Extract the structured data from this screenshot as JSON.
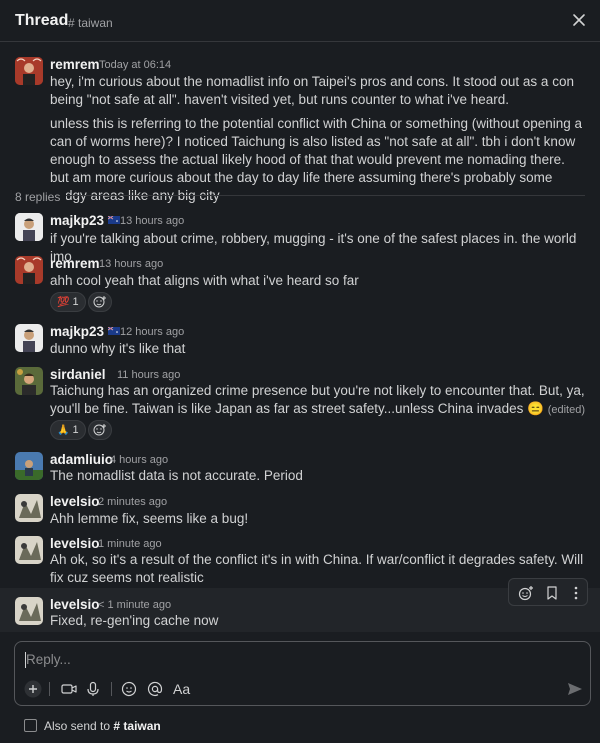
{
  "header": {
    "title": "Thread",
    "channel": "# taiwan"
  },
  "parent": {
    "user": "remrem",
    "time": "Today at 06:14",
    "para1": "hey, i'm curious about the nomadlist info on Taipei's pros and cons. It stood out as a con being \"not safe at all\". haven't visited yet, but runs counter to what i've heard.",
    "para2": "unless this is referring to the potential conflict with China or something (without opening a can of worms here)? I noticed Taichung is also listed as \"not safe at all\".  tbh i don't know enough to assess the actual likely hood of that that would prevent me nomading there. but am more curious about the day to day life there assuming there's probably some dodgy areas like any big city"
  },
  "replies_count": "8 replies",
  "replies": [
    {
      "user": "majkp23",
      "time": "13 hours ago",
      "text": "if you're talking about crime, robbery, mugging - it's one of the safest places in. the world imo"
    },
    {
      "user": "remrem",
      "time": "13 hours ago",
      "text": "ahh cool yeah that aligns with what i've heard so far",
      "reaction": {
        "emoji": "💯",
        "count": "1"
      }
    },
    {
      "user": "majkp23",
      "time": "12 hours ago",
      "text": "dunno why it's like that"
    },
    {
      "user": "sirdaniel",
      "time": "11 hours ago",
      "text": "Taichung has an organized crime presence but you're not likely to encounter that. But, ya, you'll be fine. Taiwan is like Japan as far as street safety...unless China invades",
      "emoji_inline": "😑",
      "edited": "(edited)",
      "reaction": {
        "emoji": "🙏",
        "count": "1"
      }
    },
    {
      "user": "adamliuio",
      "time": "4 hours ago",
      "text": "The nomadlist data is not accurate. Period"
    },
    {
      "user": "levelsio",
      "time": "2 minutes ago",
      "text": "Ahh lemme fix, seems like a bug!"
    },
    {
      "user": "levelsio",
      "time": "1 minute ago",
      "text": "Ah ok, so it's a result of the conflict it's in with China. If war/conflict it degrades safety. Will fix cuz seems not realistic"
    },
    {
      "user": "levelsio",
      "time": "< 1 minute ago",
      "text": "Fixed, re-gen'ing cache now"
    }
  ],
  "composer": {
    "placeholder": "Reply...",
    "format_label": "Aa"
  },
  "also_send": {
    "label": "Also send to",
    "channel": "# taiwan"
  },
  "colors": {
    "background": "#1a1d21",
    "text": "#d1d2d3",
    "muted": "#a0a1a4",
    "send": "#6b6d70"
  },
  "icons": [
    "close-icon",
    "add-reaction-icon",
    "bookmark-icon",
    "more-icon",
    "plus-icon",
    "video-icon",
    "mic-icon",
    "emoji-icon",
    "mention-icon",
    "send-icon",
    "australia-flag-icon"
  ]
}
